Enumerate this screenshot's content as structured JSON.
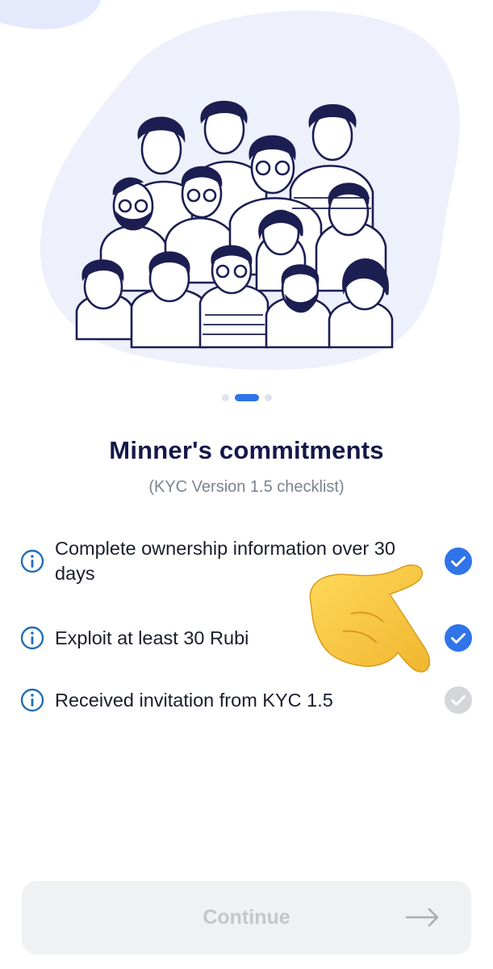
{
  "onboarding": {
    "page_indicator": {
      "total": 3,
      "current": 2
    },
    "title": "Minner's commitments",
    "subtitle": "(KYC Version 1.5 checklist)",
    "checklist": [
      {
        "label": "Complete ownership information over 30 days",
        "completed": true
      },
      {
        "label": "Exploit at least 30 Rubi",
        "completed": true
      },
      {
        "label": "Received invitation from KYC 1.5",
        "completed": false
      }
    ],
    "continue_button": {
      "label": "Continue",
      "enabled": false
    }
  },
  "icons": {
    "info": "info-circle-icon",
    "check": "check-circle-icon",
    "arrow": "arrow-right-icon",
    "pointer": "pointing-hand-emoji"
  },
  "colors": {
    "accent": "#2f74e9",
    "title": "#14184a",
    "subtitle": "#7b8390",
    "info_icon": "#1f6fb6",
    "check_done": "#2f74e9",
    "check_pending": "#d4d6da",
    "button_bg": "#f0f1f3",
    "button_text": "#c3c6cc",
    "hero_blob": "#eef0fb"
  }
}
